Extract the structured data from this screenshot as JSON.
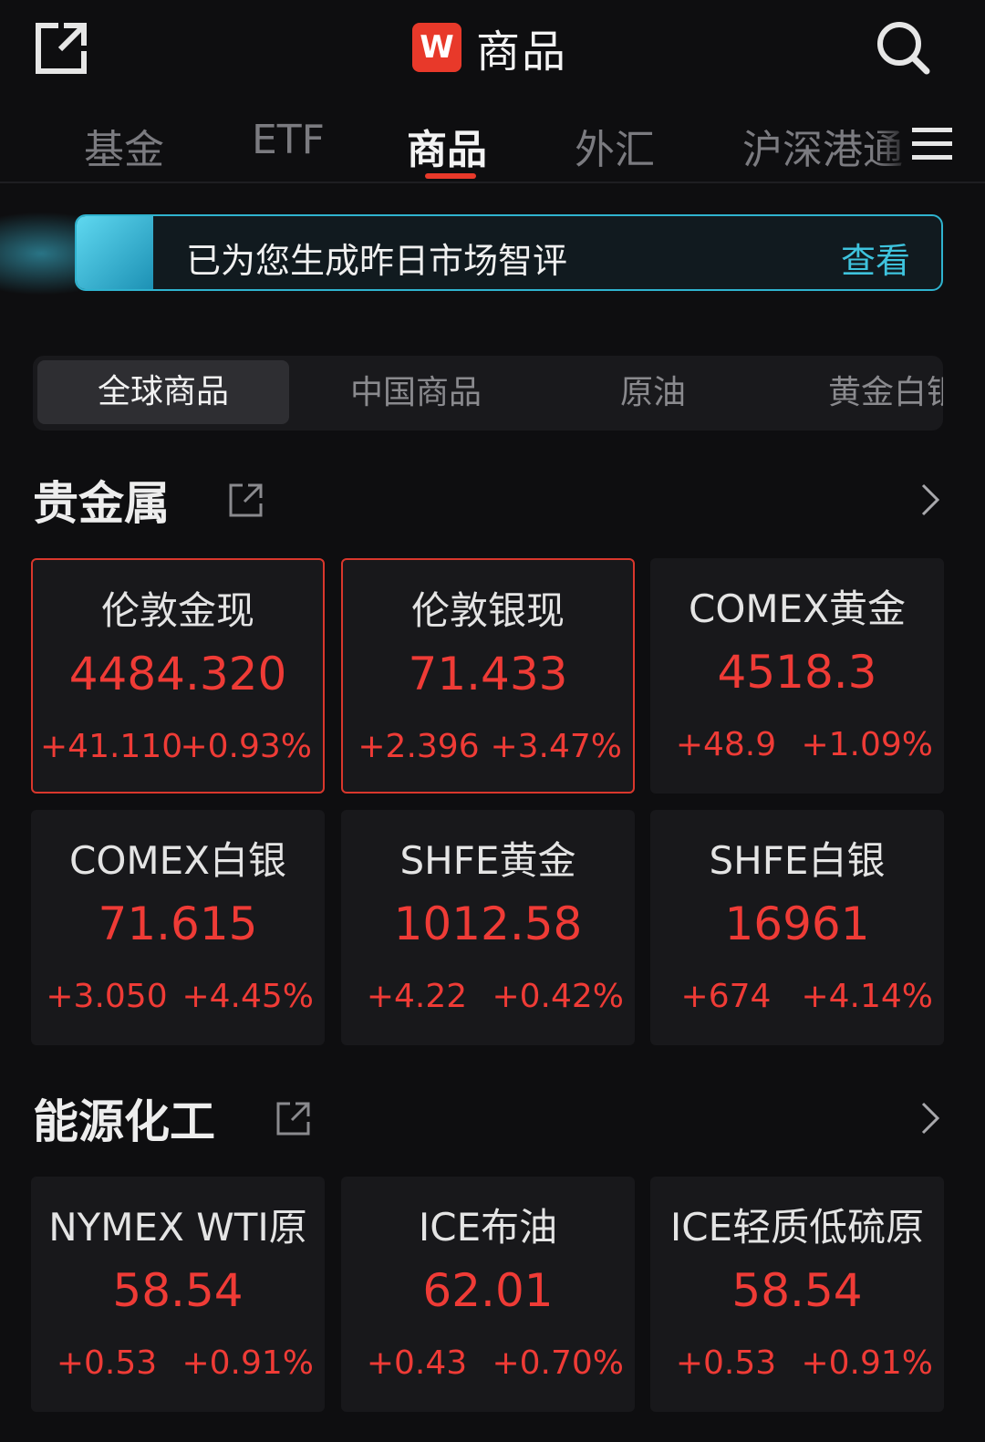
{
  "header": {
    "brand_logo": "W",
    "title": "商品",
    "share_icon": "share-icon",
    "search_icon": "search-icon"
  },
  "tabs": [
    {
      "label": "基金",
      "active": false
    },
    {
      "label": "ETF",
      "active": false
    },
    {
      "label": "商品",
      "active": true
    },
    {
      "label": "外汇",
      "active": false
    },
    {
      "label": "沪深港通",
      "active": false
    }
  ],
  "banner": {
    "text": "已为您生成昨日市场智评",
    "action": "查看"
  },
  "segments": [
    {
      "label": "全球商品",
      "active": true
    },
    {
      "label": "中国商品",
      "active": false
    },
    {
      "label": "原油",
      "active": false
    },
    {
      "label": "黄金白银",
      "active": false
    }
  ],
  "sections": [
    {
      "title": "贵金属",
      "cards": [
        {
          "name": "伦敦金现",
          "price": "4484.320",
          "change": "+41.110",
          "pct": "+0.93%",
          "highlight": true
        },
        {
          "name": "伦敦银现",
          "price": "71.433",
          "change": "+2.396",
          "pct": "+3.47%",
          "highlight": true
        },
        {
          "name": "COMEX黄金",
          "price": "4518.3",
          "change": "+48.9",
          "pct": "+1.09%",
          "highlight": false
        },
        {
          "name": "COMEX白银",
          "price": "71.615",
          "change": "+3.050",
          "pct": "+4.45%",
          "highlight": false
        },
        {
          "name": "SHFE黄金",
          "price": "1012.58",
          "change": "+4.22",
          "pct": "+0.42%",
          "highlight": false
        },
        {
          "name": "SHFE白银",
          "price": "16961",
          "change": "+674",
          "pct": "+4.14%",
          "highlight": false
        }
      ]
    },
    {
      "title": "能源化工",
      "cards": [
        {
          "name": "NYMEX WTI原",
          "price": "58.54",
          "change": "+0.53",
          "pct": "+0.91%",
          "highlight": false
        },
        {
          "name": "ICE布油",
          "price": "62.01",
          "change": "+0.43",
          "pct": "+0.70%",
          "highlight": false
        },
        {
          "name": "ICE轻质低硫原",
          "price": "58.54",
          "change": "+0.53",
          "pct": "+0.91%",
          "highlight": false
        }
      ]
    }
  ],
  "colors": {
    "background": "#0e0e10",
    "accent_red": "#e8392a",
    "rise_red": "#ef3b36",
    "ai_cyan": "#3ec3dd"
  }
}
